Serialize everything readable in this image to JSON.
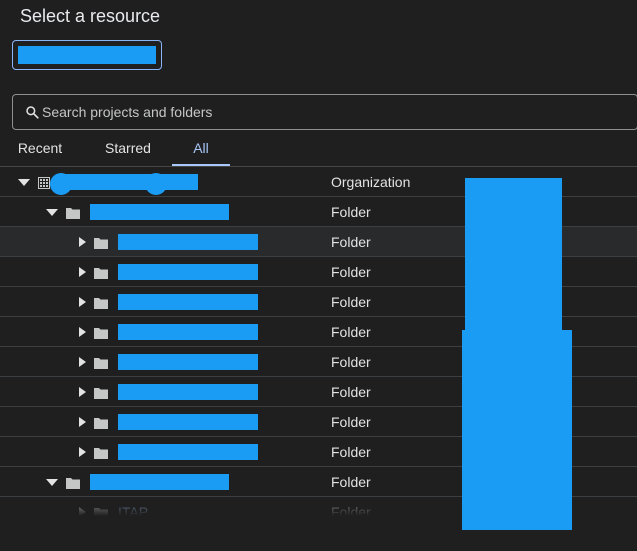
{
  "dialog": {
    "title": "Select a resource"
  },
  "search": {
    "placeholder": "Search projects and folders"
  },
  "tabs": [
    {
      "label": "Recent"
    },
    {
      "label": "Starred"
    },
    {
      "label": "All"
    }
  ],
  "rows": [
    {
      "type": "Organization",
      "icon": "organization-icon",
      "expanded": true
    },
    {
      "type": "Folder",
      "icon": "folder-icon",
      "expanded": true
    },
    {
      "type": "Folder",
      "icon": "folder-icon",
      "expanded": false
    },
    {
      "type": "Folder",
      "icon": "folder-icon",
      "expanded": false
    },
    {
      "type": "Folder",
      "icon": "folder-icon",
      "expanded": false
    },
    {
      "type": "Folder",
      "icon": "folder-icon",
      "expanded": false
    },
    {
      "type": "Folder",
      "icon": "folder-icon",
      "expanded": false
    },
    {
      "type": "Folder",
      "icon": "folder-icon",
      "expanded": false
    },
    {
      "type": "Folder",
      "icon": "folder-icon",
      "expanded": false
    },
    {
      "type": "Folder",
      "icon": "folder-icon",
      "expanded": false
    },
    {
      "type": "Folder",
      "icon": "folder-icon",
      "expanded": true
    },
    {
      "type": "Folder",
      "icon": "folder-icon",
      "expanded": false,
      "label": "ITAP"
    }
  ],
  "colors": {
    "accent": "#a8c7fa",
    "redaction": "#1a9cf4",
    "background": "#1f1f1f"
  }
}
